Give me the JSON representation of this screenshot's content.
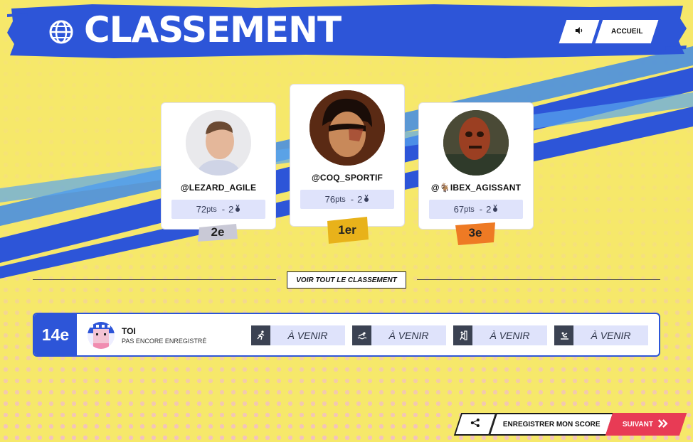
{
  "header": {
    "title": "CLASSEMENT",
    "sound_icon": "speaker-icon",
    "home_label": "ACCUEIL"
  },
  "podium": [
    {
      "place": "2e",
      "username": "@LEZARD_AGILE",
      "points": "72",
      "pts_unit": "pts",
      "medals": "2",
      "badge_color": "#c9c9d6"
    },
    {
      "place": "1er",
      "username": "@COQ_SPORTIF",
      "points": "76",
      "pts_unit": "pts",
      "medals": "2",
      "badge_color": "#e8b21a"
    },
    {
      "place": "3e",
      "username": "@🐐IBEX_AGISSANT",
      "points": "67",
      "pts_unit": "pts",
      "medals": "2",
      "badge_color": "#ee7a24"
    }
  ],
  "stat_separator": "-",
  "see_all_label": "VOIR TOUT LE CLASSEMENT",
  "me": {
    "rank": "14e",
    "name": "TOI",
    "subtitle": "PAS ENCORE ENREGISTRÉ",
    "events": [
      {
        "icon": "running-icon",
        "label": "À VENIR"
      },
      {
        "icon": "swimming-icon",
        "label": "À VENIR"
      },
      {
        "icon": "climbing-icon",
        "label": "À VENIR"
      },
      {
        "icon": "rowing-icon",
        "label": "À VENIR"
      }
    ]
  },
  "footer": {
    "share_icon": "share-icon",
    "save_label": "ENREGISTRER MON SCORE",
    "next_label": "SUIVANT"
  },
  "colors": {
    "accent_blue": "#2d55d8",
    "background_yellow": "#f6e86a",
    "next_red": "#e83b55"
  }
}
